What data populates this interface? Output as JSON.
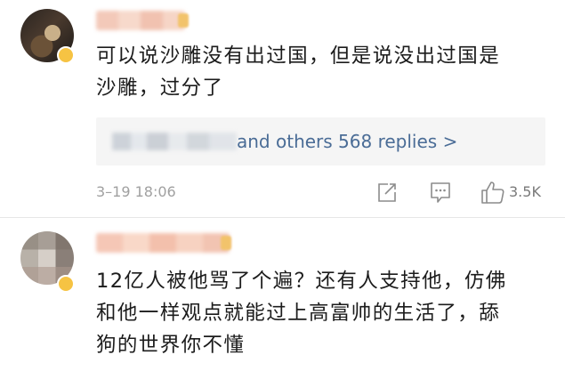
{
  "comments": [
    {
      "text_line1": "可以说沙雕没有出过国，但是说没出过国是",
      "text_line2": "沙雕，过分了",
      "replies": {
        "and_label": "and",
        "others_label": "others 568 replies >"
      },
      "timestamp": "3–19 18:06",
      "likes": "3.5K"
    },
    {
      "text_line1": "12亿人被他骂了个遍？还有人支持他，仿佛",
      "text_line2": "和他一样观点就能过上高富帅的生活了，舔",
      "text_line3": "狗的世界你不懂"
    }
  ],
  "icons": {
    "share": "share-icon",
    "reply": "comment-icon",
    "like": "thumbs-up-icon"
  },
  "colors": {
    "link": "#4a6c96",
    "text": "#1c1c1c",
    "meta": "#a0a0a0",
    "reply_bg": "#f5f5f5"
  }
}
